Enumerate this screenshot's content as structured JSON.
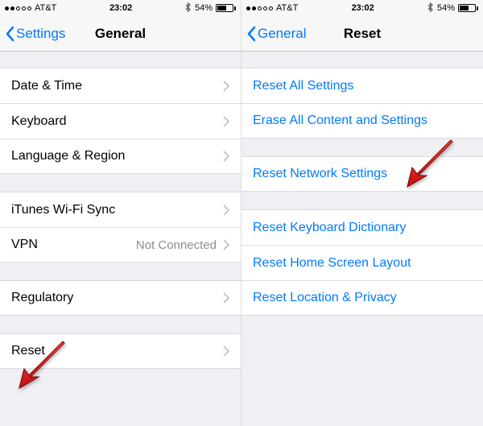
{
  "statusBar": {
    "carrier": "AT&T",
    "time": "23:02",
    "batteryPercent": "54%",
    "signalFilled": 2,
    "signalTotal": 5
  },
  "left": {
    "back": "Settings",
    "title": "General",
    "groups": [
      [
        {
          "label": "Date & Time"
        },
        {
          "label": "Keyboard"
        },
        {
          "label": "Language & Region"
        }
      ],
      [
        {
          "label": "iTunes Wi-Fi Sync"
        },
        {
          "label": "VPN",
          "detail": "Not Connected"
        }
      ],
      [
        {
          "label": "Regulatory"
        }
      ],
      [
        {
          "label": "Reset"
        }
      ]
    ]
  },
  "right": {
    "back": "General",
    "title": "Reset",
    "groups": [
      [
        {
          "label": "Reset All Settings"
        },
        {
          "label": "Erase All Content and Settings"
        }
      ],
      [
        {
          "label": "Reset Network Settings"
        }
      ],
      [
        {
          "label": "Reset Keyboard Dictionary"
        },
        {
          "label": "Reset Home Screen Layout"
        },
        {
          "label": "Reset Location & Privacy"
        }
      ]
    ]
  }
}
